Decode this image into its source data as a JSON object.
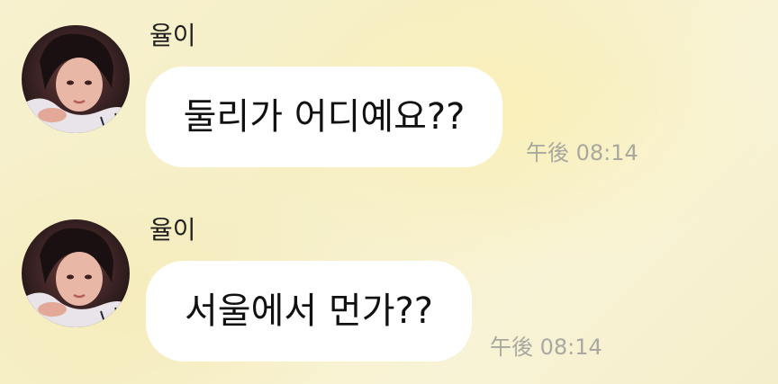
{
  "messages": [
    {
      "sender": "율이",
      "text": "둘리가 어디예요??",
      "time": "午後 08:14"
    },
    {
      "sender": "율이",
      "text": "서울에서 먼가??",
      "time": "午後 08:14"
    }
  ]
}
